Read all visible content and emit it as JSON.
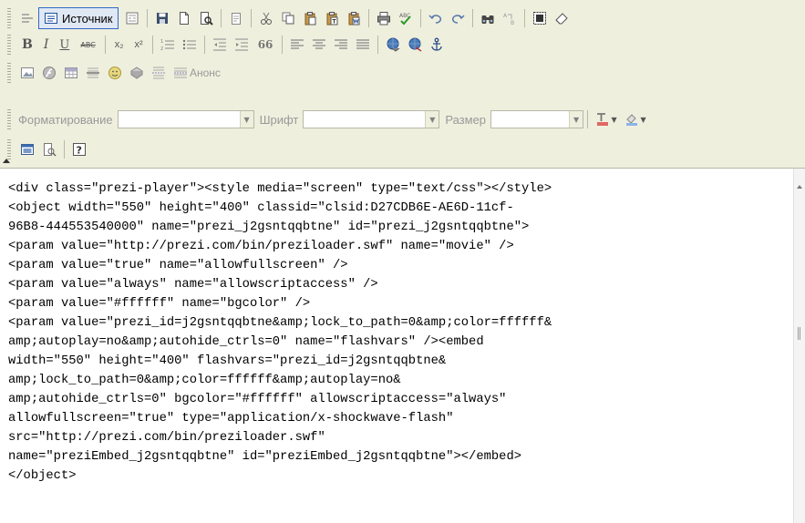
{
  "toolbar": {
    "source_label": "Источник",
    "anons_label": "Анонс",
    "format_label": "Форматирование",
    "format_value": "",
    "font_label": "Шрифт",
    "font_value": "",
    "size_label": "Размер",
    "size_value": "",
    "bold_glyph": "B",
    "italic_glyph": "I",
    "underline_glyph": "U",
    "strike_glyph": "ABC",
    "subscript_glyph": "x₂",
    "superscript_glyph": "x²",
    "quote_glyph": "66",
    "help_glyph": "?",
    "icons": [
      "source-icon",
      "templates-icon",
      "save-icon",
      "new-page-icon",
      "preview-icon",
      "paste-icon",
      "cut-icon",
      "copy-icon",
      "paste-text-icon",
      "paste-word-icon",
      "print-icon",
      "spellcheck-icon",
      "undo-icon",
      "redo-icon",
      "find-icon",
      "replace-icon",
      "select-all-icon",
      "remove-format-icon",
      "ordered-list-icon",
      "unordered-list-icon",
      "outdent-icon",
      "indent-icon",
      "align-left-icon",
      "align-center-icon",
      "align-right-icon",
      "justify-icon",
      "link-icon",
      "unlink-icon",
      "anchor-icon",
      "image-icon",
      "flash-icon",
      "table-icon",
      "horizontal-rule-icon",
      "smiley-icon",
      "special-char-icon",
      "page-break-icon",
      "text-color-icon",
      "background-color-icon",
      "maximize-icon",
      "show-blocks-icon",
      "about-icon"
    ]
  },
  "colors": {
    "toolbar_bg": "#efefde",
    "active_button_bg": "#e0e8f4",
    "active_button_border": "#316ac5"
  },
  "source": {
    "lines": [
      "<div class=\"prezi-player\"><style media=\"screen\" type=\"text/css\"></style>",
      "<object width=\"550\" height=\"400\" classid=\"clsid:D27CDB6E-AE6D-11cf-",
      "96B8-444553540000\" name=\"prezi_j2gsntqqbtne\" id=\"prezi_j2gsntqqbtne\">",
      "<param value=\"http://prezi.com/bin/preziloader.swf\" name=\"movie\" />",
      "<param value=\"true\" name=\"allowfullscreen\" />",
      "<param value=\"always\" name=\"allowscriptaccess\" />",
      "<param value=\"#ffffff\" name=\"bgcolor\" />",
      "<param value=\"prezi_id=j2gsntqqbtne&amp;lock_to_path=0&amp;color=ffffff&",
      "amp;autoplay=no&amp;autohide_ctrls=0\" name=\"flashvars\" /><embed",
      "width=\"550\" height=\"400\" flashvars=\"prezi_id=j2gsntqqbtne&",
      "amp;lock_to_path=0&amp;color=ffffff&amp;autoplay=no&",
      "amp;autohide_ctrls=0\" bgcolor=\"#ffffff\" allowscriptaccess=\"always\"",
      "allowfullscreen=\"true\" type=\"application/x-shockwave-flash\"",
      "src=\"http://prezi.com/bin/preziloader.swf\"",
      "name=\"preziEmbed_j2gsntqqbtne\" id=\"preziEmbed_j2gsntqqbtne\"></embed>",
      "</object>"
    ]
  }
}
